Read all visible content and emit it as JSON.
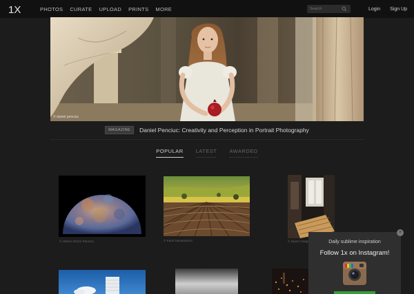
{
  "brand": {
    "logo_text": "1X"
  },
  "nav": {
    "items": [
      "PHOTOS",
      "CURATE",
      "UPLOAD",
      "PRINTS",
      "MORE"
    ]
  },
  "search": {
    "placeholder": "Search"
  },
  "auth": {
    "login": "Login",
    "signup": "Sign Up"
  },
  "hero": {
    "credit": "© daniel penciuc"
  },
  "headline": {
    "badge": "MAGAZINE",
    "title": "Daniel Penciuc: Creativity and Perception in Portrait Photography"
  },
  "tabs": [
    {
      "label": "POPULAR",
      "active": true
    },
    {
      "label": "LATEST",
      "active": false
    },
    {
      "label": "AWARDED",
      "active": false
    }
  ],
  "gallery": {
    "credits": [
      "© Alberto Ghizzi Panizza",
      "© Karol Nienartowicz",
      "© Niyazi Gürgen"
    ]
  },
  "popup": {
    "subtitle": "Daily sublime inspiration",
    "title": "Follow 1x on Instagram!",
    "close": "×"
  },
  "colors": {
    "background": "#1c1c1c",
    "topbar": "#111111",
    "popup": "#2f2f2f",
    "follow_button": "#3a9b3a"
  }
}
